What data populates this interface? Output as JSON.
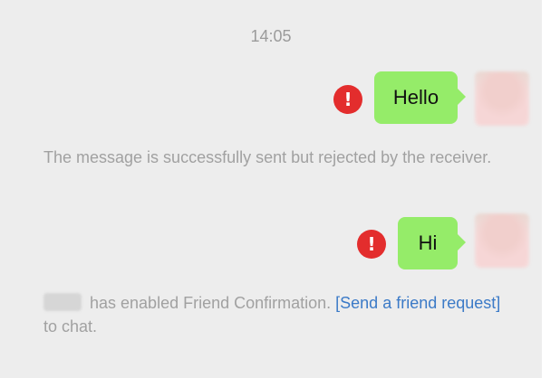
{
  "chat": {
    "timestamp": "14:05",
    "messages": [
      {
        "text": "Hello",
        "status": "error",
        "status_icon": "exclamation-icon"
      },
      {
        "text": "Hi",
        "status": "error",
        "status_icon": "exclamation-icon"
      }
    ],
    "system_notes": {
      "rejected": "The message is successfully sent but rejected by the receiver.",
      "friend_confirmation": {
        "middle": " has enabled Friend Confirmation. ",
        "link": "[Send a friend request]",
        "suffix": " to chat."
      }
    }
  },
  "colors": {
    "background": "#ededed",
    "bubble": "#95ec69",
    "error": "#e32d2d",
    "link": "#3b7ac7",
    "system_text": "#a1a1a1"
  }
}
